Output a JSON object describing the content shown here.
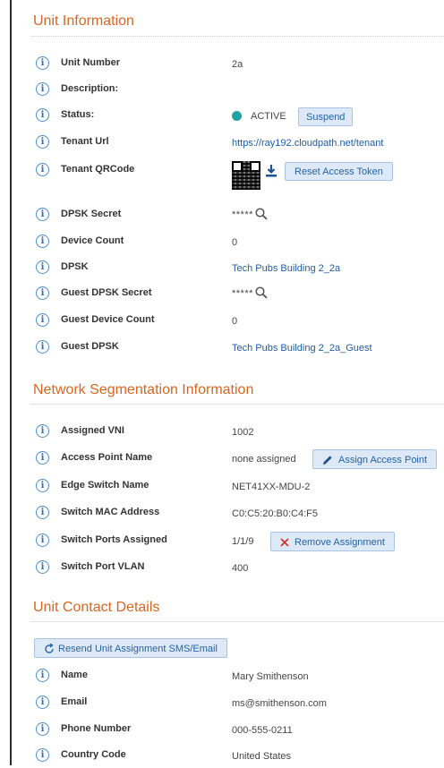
{
  "sections": {
    "unit_info": "Unit Information",
    "network": "Network Segmentation Information",
    "contact": "Unit Contact Details"
  },
  "unit_info": {
    "unit_number_label": "Unit Number",
    "unit_number": "2a",
    "description_label": "Description:",
    "status_label": "Status:",
    "status_value": "ACTIVE",
    "status_color": "#22a3a3",
    "suspend_btn": "Suspend",
    "tenant_url_label": "Tenant Url",
    "tenant_url": "https://ray192.cloudpath.net/tenant",
    "tenant_qr_label": "Tenant QRCode",
    "reset_token_btn": "Reset Access Token",
    "dpsk_secret_label": "DPSK Secret",
    "dpsk_secret": "*****",
    "device_count_label": "Device Count",
    "device_count": "0",
    "dpsk_label": "DPSK",
    "dpsk": "Tech Pubs Building 2_2a",
    "guest_dpsk_secret_label": "Guest DPSK Secret",
    "guest_dpsk_secret": "*****",
    "guest_device_count_label": "Guest Device Count",
    "guest_device_count": "0",
    "guest_dpsk_label": "Guest DPSK",
    "guest_dpsk": "Tech Pubs Building 2_2a_Guest"
  },
  "network": {
    "vni_label": "Assigned VNI",
    "vni": "1002",
    "ap_name_label": "Access Point Name",
    "ap_name": "none assigned",
    "assign_ap_btn": "Assign Access Point",
    "edge_switch_label": "Edge Switch Name",
    "edge_switch": "NET41XX-MDU-2",
    "mac_label": "Switch MAC Address",
    "mac": "C0:C5:20:B0:C4:F5",
    "ports_label": "Switch Ports Assigned",
    "ports": "1/1/9",
    "remove_btn": "Remove Assignment",
    "vlan_label": "Switch Port VLAN",
    "vlan": "400"
  },
  "contact": {
    "resend_btn": "Resend Unit Assignment SMS/Email",
    "name_label": "Name",
    "name": "Mary Smithenson",
    "email_label": "Email",
    "email": "ms@smithenson.com",
    "phone_label": "Phone Number",
    "phone": "000-555-0211",
    "country_label": "Country Code",
    "country": "United States"
  },
  "icons": {
    "info": "i"
  },
  "colors": {
    "accent": "#d9661f",
    "link": "#1f5da8",
    "button_bg": "#dde9f6"
  }
}
